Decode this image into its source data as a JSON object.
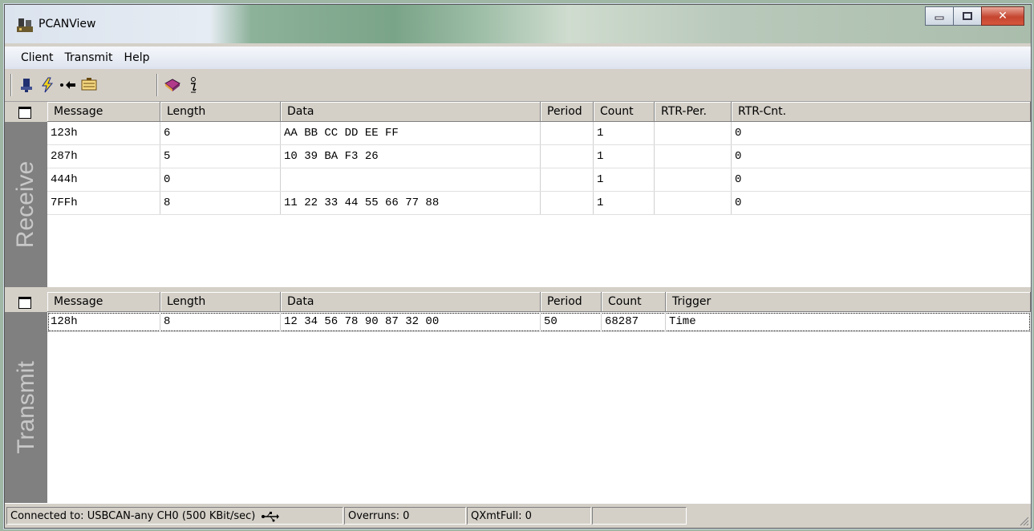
{
  "window": {
    "title": "PCANView"
  },
  "menu": [
    "Client",
    "Transmit",
    "Help"
  ],
  "toolbar": {
    "group1": [
      "connect-icon",
      "lightning-icon",
      "arrow-left-icon",
      "bus-icon"
    ],
    "group2": [
      "help-book-icon",
      "info-icon"
    ]
  },
  "receive": {
    "label": "Receive",
    "columns": [
      "Message",
      "Length",
      "Data",
      "Period",
      "Count",
      "RTR-Per.",
      "RTR-Cnt."
    ],
    "rows": [
      [
        "123h",
        "6",
        "AA BB CC DD EE FF",
        "",
        "1",
        "",
        "0"
      ],
      [
        "287h",
        "5",
        "10 39 BA F3 26",
        "",
        "1",
        "",
        "0"
      ],
      [
        "444h",
        "0",
        "",
        "",
        "1",
        "",
        "0"
      ],
      [
        "7FFh",
        "8",
        "11 22 33 44 55 66 77 88",
        "",
        "1",
        "",
        "0"
      ]
    ]
  },
  "transmit": {
    "label": "Transmit",
    "columns": [
      "Message",
      "Length",
      "Data",
      "Period",
      "Count",
      "Trigger"
    ],
    "rows": [
      [
        "128h",
        "8",
        "12 34 56 78 90 87 32 00",
        "50",
        "68287",
        "Time"
      ]
    ]
  },
  "status": {
    "connected": "Connected to: USBCAN-any CH0  (500 KBit/sec)",
    "overruns": "Overruns: 0",
    "qxmtfull": "QXmtFull: 0",
    "extra": ""
  }
}
